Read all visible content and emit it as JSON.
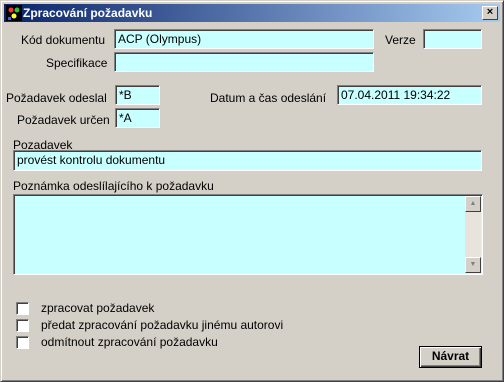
{
  "window": {
    "title": "Zpracování požadavku",
    "close_label": "×"
  },
  "icons": {
    "app": "app-icon",
    "close": "close-icon",
    "scroll_up": "scroll-up-icon",
    "scroll_down": "scroll-down-icon"
  },
  "form": {
    "kod_dokumentu": {
      "label": "Kód dokumentu",
      "value": "ACP  (Olympus)"
    },
    "verze": {
      "label": "Verze",
      "value": ""
    },
    "specifikace": {
      "label": "Specifikace",
      "value": ""
    },
    "pozadavek_odeslal": {
      "label": "Požadavek odeslal",
      "value": "*B"
    },
    "pozadavek_urcen": {
      "label": "Požadavek určen",
      "value": "*A"
    },
    "datum_odeslani": {
      "label": "Datum a čas odeslání",
      "value": "07.04.2011 19:34:22"
    },
    "pozadavek": {
      "label": "Pozadavek",
      "value": "provést kontrolu dokumentu"
    },
    "poznamka": {
      "label": "Poznámka odeslílajícího k požadavku",
      "value": ""
    }
  },
  "options": [
    {
      "label": "zpracovat požadavek",
      "checked": false
    },
    {
      "label": "předat zpracování požadavku jinému autorovi",
      "checked": false
    },
    {
      "label": "odmítnout zpracování požadavku",
      "checked": false
    }
  ],
  "buttons": {
    "back_label": "Návrat"
  },
  "colors": {
    "field_bg": "#c8ffff",
    "title_start": "#0a246a",
    "title_end": "#a6caf0",
    "face": "#d4d0c8"
  }
}
